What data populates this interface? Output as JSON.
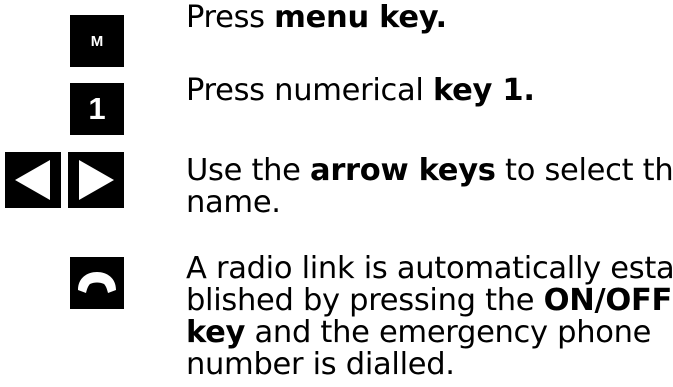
{
  "steps": [
    {
      "key": {
        "label": "M",
        "icon": "menu-key-icon"
      },
      "pre": "Press ",
      "bold": "menu key.",
      "post": ""
    },
    {
      "key": {
        "label": "1",
        "icon": "number-1-key-icon"
      },
      "pre": "Press numerical ",
      "bold": "key 1.",
      "post": ""
    },
    {
      "key": {
        "icons": [
          "arrow-left-key-icon",
          "arrow-right-key-icon"
        ]
      },
      "line1_pre": "Use the ",
      "line1_bold": "arrow keys",
      "line1_post": " to select the",
      "line2": "name."
    },
    {
      "key": {
        "icon": "handset-onoff-key-icon"
      },
      "line1": "A radio link is automatically esta-",
      "line2_pre": "blished by pressing the ",
      "line2_bold": "ON/OFF",
      "line3_bold": "key",
      "line3_post": " and the emergency phone",
      "line4": "number is dialled."
    }
  ],
  "colors": {
    "key_bg": "#000000",
    "key_fg": "#ffffff",
    "text": "#000000"
  }
}
